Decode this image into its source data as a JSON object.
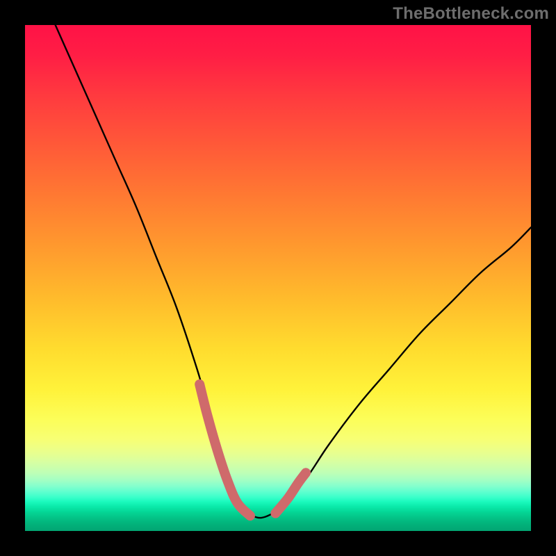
{
  "watermark": "TheBottleneck.com",
  "chart_data": {
    "type": "line",
    "title": "",
    "xlabel": "",
    "ylabel": "",
    "xlim": [
      0,
      100
    ],
    "ylim": [
      0,
      100
    ],
    "curve_main": {
      "name": "bottleneck-curve",
      "x": [
        6,
        10,
        14,
        18,
        22,
        26,
        30,
        34,
        36,
        38,
        40,
        42,
        45,
        48,
        52,
        56,
        60,
        66,
        72,
        78,
        84,
        90,
        96,
        100
      ],
      "y_pct": [
        100,
        91,
        82,
        73,
        64,
        54,
        44,
        32,
        25,
        18,
        11,
        6,
        3,
        3,
        6,
        11,
        17,
        25,
        32,
        39,
        45,
        51,
        56,
        60
      ]
    },
    "curve_highlight": {
      "name": "highlight-segments",
      "segments": [
        {
          "x": [
            34.5,
            36,
            38,
            40,
            42,
            44.5
          ],
          "y_pct": [
            29,
            23,
            16,
            10,
            5.5,
            3
          ]
        },
        {
          "x": [
            49.5,
            52,
            54,
            55.5
          ],
          "y_pct": [
            3.5,
            6.5,
            9.5,
            11.5
          ]
        }
      ]
    },
    "colors": {
      "curve": "#000000",
      "highlight": "#cf6a6b",
      "gradient_top": "#ff1246",
      "gradient_bottom": "#02a572"
    }
  }
}
